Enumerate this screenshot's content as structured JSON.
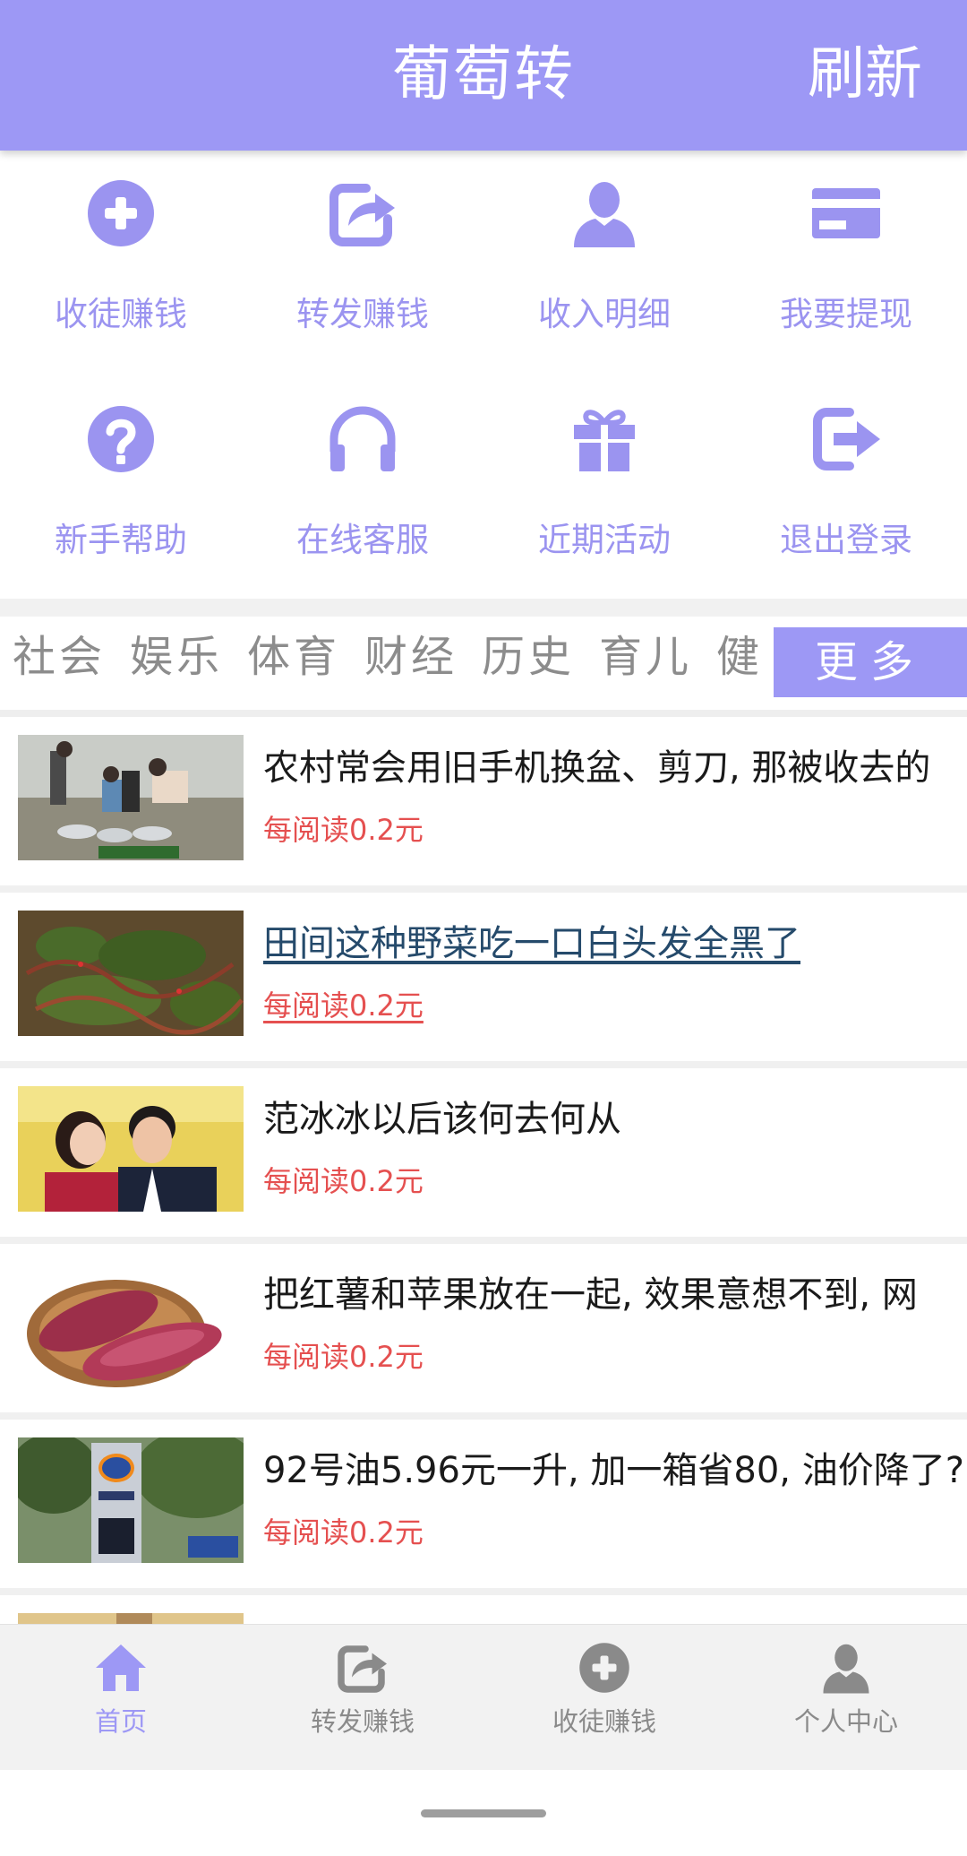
{
  "header": {
    "title": "葡萄转",
    "refresh_label": "刷新"
  },
  "grid": {
    "items": [
      {
        "label": "收徒赚钱",
        "icon": "plus-circle-icon"
      },
      {
        "label": "转发赚钱",
        "icon": "share-icon"
      },
      {
        "label": "收入明细",
        "icon": "user-icon"
      },
      {
        "label": "我要提现",
        "icon": "card-icon"
      },
      {
        "label": "新手帮助",
        "icon": "help-circle-icon"
      },
      {
        "label": "在线客服",
        "icon": "headphones-icon"
      },
      {
        "label": "近期活动",
        "icon": "gift-icon"
      },
      {
        "label": "退出登录",
        "icon": "logout-icon"
      }
    ]
  },
  "categories": {
    "items": [
      "社会",
      "娱乐",
      "体育",
      "财经",
      "历史",
      "育儿",
      "健"
    ],
    "more_label": "更多"
  },
  "articles": [
    {
      "title": "农村常会用旧手机换盆、剪刀, 那被收去的",
      "price": "每阅读0.2元",
      "visited": false,
      "thumb": "people-trading-basins-image"
    },
    {
      "title": "田间这种野菜吃一口白头发全黑了",
      "price": "每阅读0.2元",
      "visited": true,
      "thumb": "wild-vegetable-image"
    },
    {
      "title": "范冰冰以后该何去何从",
      "price": "每阅读0.2元",
      "visited": false,
      "thumb": "couple-photo-image"
    },
    {
      "title": "把红薯和苹果放在一起, 效果意想不到, 网",
      "price": "每阅读0.2元",
      "visited": false,
      "thumb": "sweet-potato-image"
    },
    {
      "title": "92号油5.96元一升, 加一箱省80, 油价降了?",
      "price": "每阅读0.2元",
      "visited": false,
      "thumb": "gas-station-sign-image"
    }
  ],
  "bottom_nav": {
    "items": [
      {
        "label": "首页",
        "icon": "home-icon",
        "active": true
      },
      {
        "label": "转发赚钱",
        "icon": "share-icon",
        "active": false
      },
      {
        "label": "收徒赚钱",
        "icon": "plus-circle-icon",
        "active": false
      },
      {
        "label": "个人中心",
        "icon": "user-icon",
        "active": false
      }
    ]
  },
  "colors": {
    "accent": "#9d98f5",
    "price": "#e55050",
    "visited_link": "#254a6b"
  }
}
